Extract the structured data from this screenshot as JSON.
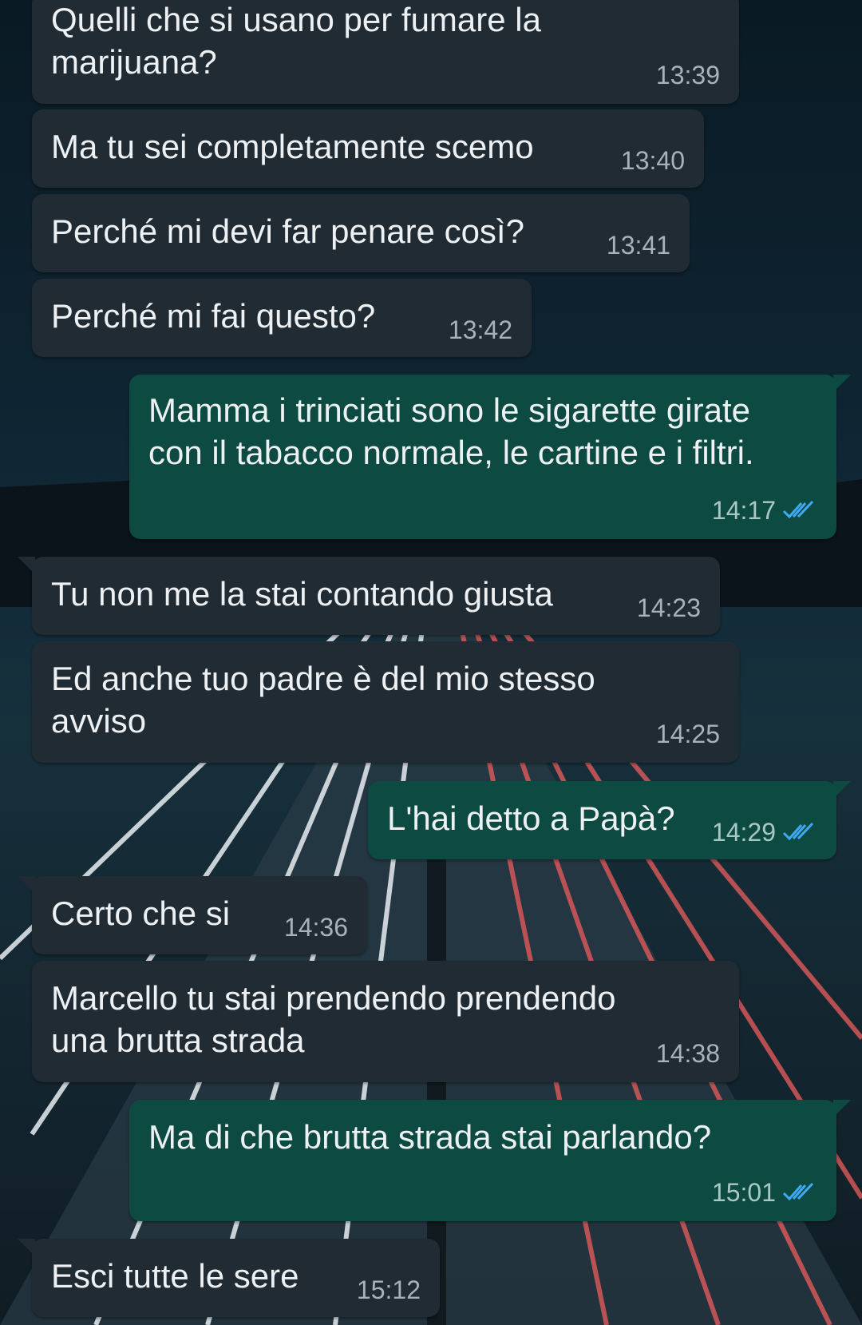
{
  "colors": {
    "incoming_bubble": "#212b33",
    "outgoing_bubble": "#0c4a42",
    "read_ticks": "#3fa9f5",
    "text": "#eef1f3",
    "time_text": "#a6b3bb"
  },
  "messages": [
    {
      "dir": "in",
      "text": "Quelli che si usano per fumare la\nmarijuana?",
      "time": "13:39"
    },
    {
      "dir": "in",
      "text": "Ma tu sei completamente scemo",
      "time": "13:40"
    },
    {
      "dir": "in",
      "text": "Perché mi devi far penare così?",
      "time": "13:41"
    },
    {
      "dir": "in",
      "text": "Perché mi fai questo?",
      "time": "13:42"
    },
    {
      "dir": "out",
      "text": "Mamma i trinciati sono le sigarette girate\ncon il tabacco normale, le cartine e i filtri.",
      "time": "14:17",
      "status_icon": "double-check-read-icon"
    },
    {
      "dir": "in",
      "text": "Tu non me la stai contando giusta",
      "time": "14:23"
    },
    {
      "dir": "in",
      "text": "Ed anche tuo padre è del mio stesso\navviso",
      "time": "14:25"
    },
    {
      "dir": "out",
      "text": "L'hai detto a Papà?",
      "time": "14:29",
      "status_icon": "double-check-read-icon"
    },
    {
      "dir": "in",
      "text": "Certo che si",
      "time": "14:36"
    },
    {
      "dir": "in",
      "text": "Marcello tu stai prendendo prendendo\nuna brutta strada",
      "time": "14:38"
    },
    {
      "dir": "out",
      "text": "Ma di che brutta strada stai parlando?",
      "time": "15:01",
      "status_icon": "double-check-read-icon"
    },
    {
      "dir": "in",
      "text": "Esci tutte le sere",
      "time": "15:12"
    }
  ]
}
